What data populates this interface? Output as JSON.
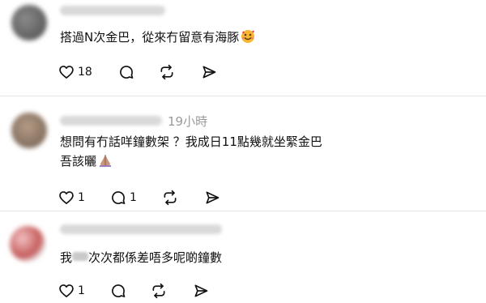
{
  "comments": [
    {
      "text": "搭過N次金巴，從來冇留意有海豚",
      "time": "",
      "likes": "18",
      "replies": ""
    },
    {
      "text_line1": "想問有冇話咩鐘數架 ？我成日11點幾就坐緊金巴",
      "text_line2": "吾該曬",
      "time": "19小時",
      "likes": "1",
      "replies": "1"
    },
    {
      "text_before": "我",
      "text_after": "次次都係差唔多呢啲鐘數",
      "time": "",
      "likes": "1",
      "replies": ""
    }
  ],
  "icons": {
    "like": "heart-icon",
    "reply": "comment-bubble-icon",
    "repost": "repost-icon",
    "share": "send-icon",
    "emoji_1": "smiling-face-with-hearts-emoji",
    "emoji_2": "folded-hands-emoji"
  },
  "colors": {
    "text": "#111111",
    "muted": "#9a9a9a",
    "divider": "#e6e6e6",
    "background": "#ffffff"
  }
}
